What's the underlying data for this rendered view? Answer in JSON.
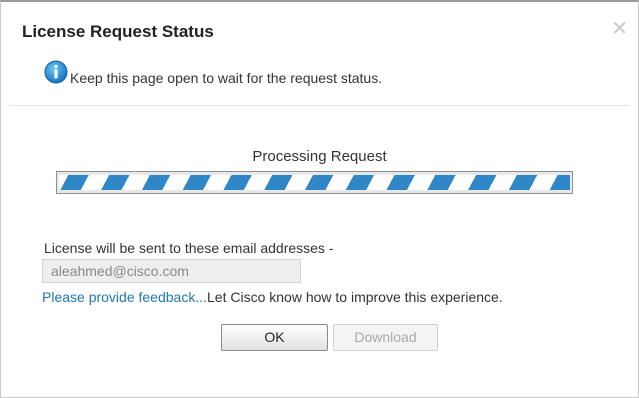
{
  "dialog": {
    "title": "License Request Status",
    "close_icon": "close-icon",
    "info": {
      "icon": "info-icon",
      "text": "Keep this page open to wait for the request status."
    },
    "progress": {
      "label": "Processing Request",
      "style": "indeterminate",
      "color": "#2f87c8"
    },
    "email": {
      "label": "License will be sent to these email addresses -",
      "value": "aleahmed@cisco.com"
    },
    "feedback": {
      "link_text": "Please provide feedback...",
      "text": "Let Cisco know how to improve this experience."
    },
    "buttons": {
      "ok": "OK",
      "download": "Download"
    }
  }
}
